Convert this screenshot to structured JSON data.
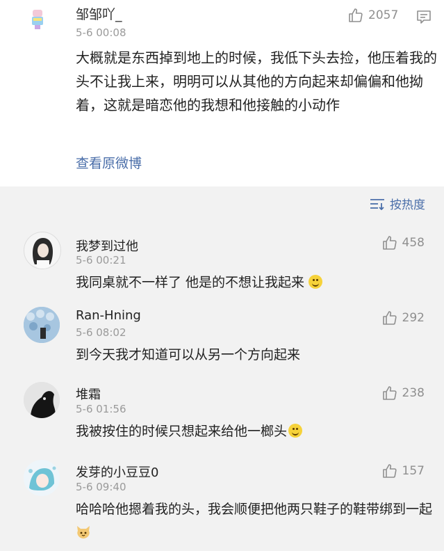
{
  "top_post": {
    "user": "邹邹吖_",
    "time": "5-6 00:08",
    "likes": "2057",
    "text": "大概就是东西掉到地上的时候，我低下头去捡，他压着我的头不让我上来，明明可以从其他的方向起来却偏偏和他拗着，这就是暗恋他的我想和他接触的小动作",
    "view_original": "查看原微博"
  },
  "sort": {
    "label": "按热度"
  },
  "comments": [
    {
      "user": "我梦到过他",
      "time": "5-6 00:21",
      "likes": "458",
      "text": "我同桌就不一样了 他是的不想让我起来"
    },
    {
      "user": "Ran-Hning",
      "time": "5-6 08:02",
      "likes": "292",
      "text": "到今天我才知道可以从另一个方向起来"
    },
    {
      "user": "堆霜",
      "time": "5-6 01:56",
      "likes": "238",
      "text": "我被按住的时候只想起来给他一榔头"
    },
    {
      "user": "发芽的小豆豆0",
      "time": "5-6 09:40",
      "likes": "157",
      "text": "哈哈哈他摁着我的头，我会顺便把他两只鞋子的鞋带绑到一起"
    }
  ],
  "colors": {
    "link": "#4a6ea9",
    "muted": "#9a9a9a",
    "background": "#f2f2f2"
  }
}
